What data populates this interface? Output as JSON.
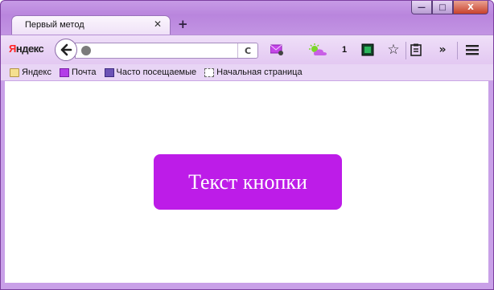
{
  "window": {
    "caption": {
      "minimize_label": "—",
      "maximize_label": "□",
      "close_label": "X"
    }
  },
  "tabs": [
    {
      "title": "Первый метод",
      "close_label": "✕",
      "active": true
    }
  ],
  "new_tab_label": "+",
  "toolbar": {
    "brand": {
      "first_letter": "Я",
      "rest": "ндекс"
    },
    "url": {
      "value": "",
      "placeholder": ""
    },
    "reload_label": "C",
    "counter": "1",
    "more_label": "»",
    "icons": [
      "back-arrow-icon",
      "globe-icon",
      "reload-icon",
      "mail-icon",
      "weather-icon",
      "green-extension-icon",
      "bookmark-star-icon",
      "clipboard-icon",
      "overflow-icon",
      "hamburger-menu-icon"
    ]
  },
  "bookmarks": [
    {
      "label": "Яндекс",
      "icon": "yandex-folder-icon"
    },
    {
      "label": "Почта",
      "icon": "mail-icon"
    },
    {
      "label": "Часто посещаемые",
      "icon": "most-visited-icon"
    },
    {
      "label": "Начальная страница",
      "icon": "blank-page-icon"
    }
  ],
  "content": {
    "button_label": "Текст кнопки"
  },
  "colors": {
    "window_frame": "#b985dd",
    "button_bg": "#bd1ce8",
    "button_text": "#ffffff",
    "close_button": "#c8412c"
  }
}
